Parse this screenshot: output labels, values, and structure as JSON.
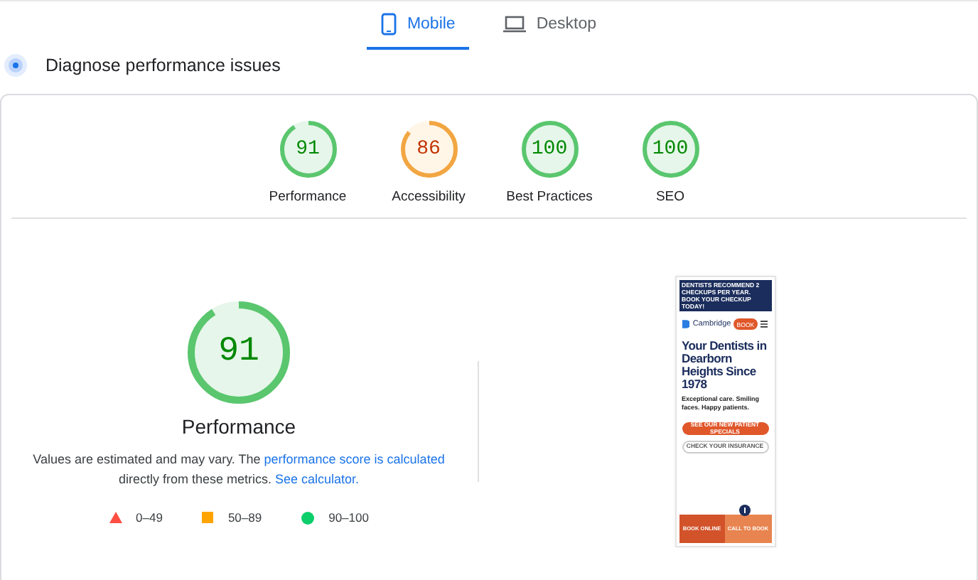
{
  "tabs": [
    {
      "label": "Mobile",
      "kind": "phone",
      "selected": true
    },
    {
      "label": "Desktop",
      "kind": "laptop",
      "selected": false
    }
  ],
  "heading": "Diagnose performance issues",
  "categories": [
    {
      "score": "91",
      "label": "Performance",
      "kind": "pass",
      "level": 0.91
    },
    {
      "score": "86",
      "label": "Accessibility",
      "kind": "average",
      "level": 0.86
    },
    {
      "score": "100",
      "label": "Best Practices",
      "kind": "pass",
      "level": 1
    },
    {
      "score": "100",
      "label": "SEO",
      "kind": "pass",
      "level": 1
    }
  ],
  "main_gauge": {
    "score": "91",
    "label": "Performance",
    "kind": "pass",
    "level": 0.91
  },
  "note": {
    "text": "Values are estimated and may vary. The ",
    "link": "performance score is calculated",
    "text2": "directly from these metrics. ",
    "link2": "See calculator."
  },
  "legend": [
    {
      "kind": "fail",
      "label": "0–49"
    },
    {
      "kind": "average",
      "label": "50–89"
    },
    {
      "kind": "pass",
      "label": "90–100"
    }
  ],
  "preview": {
    "banner": "DENTISTS RECOMMEND 2 CHECKUPS PER YEAR. BOOK YOUR CHECKUP TODAY!",
    "logo": "Cambridge",
    "book": "BOOK",
    "title": "Your Dentists in Dearborn Heights Since 1978",
    "subtitle": "Exceptional care. Smiling faces. Happy patients.",
    "primary": "SEE OUR NEW PATIENT SPECIALS",
    "secondary": "CHECK YOUR INSURANCE",
    "bottom": [
      "BOOK ONLINE",
      "CALL TO BOOK"
    ]
  }
}
